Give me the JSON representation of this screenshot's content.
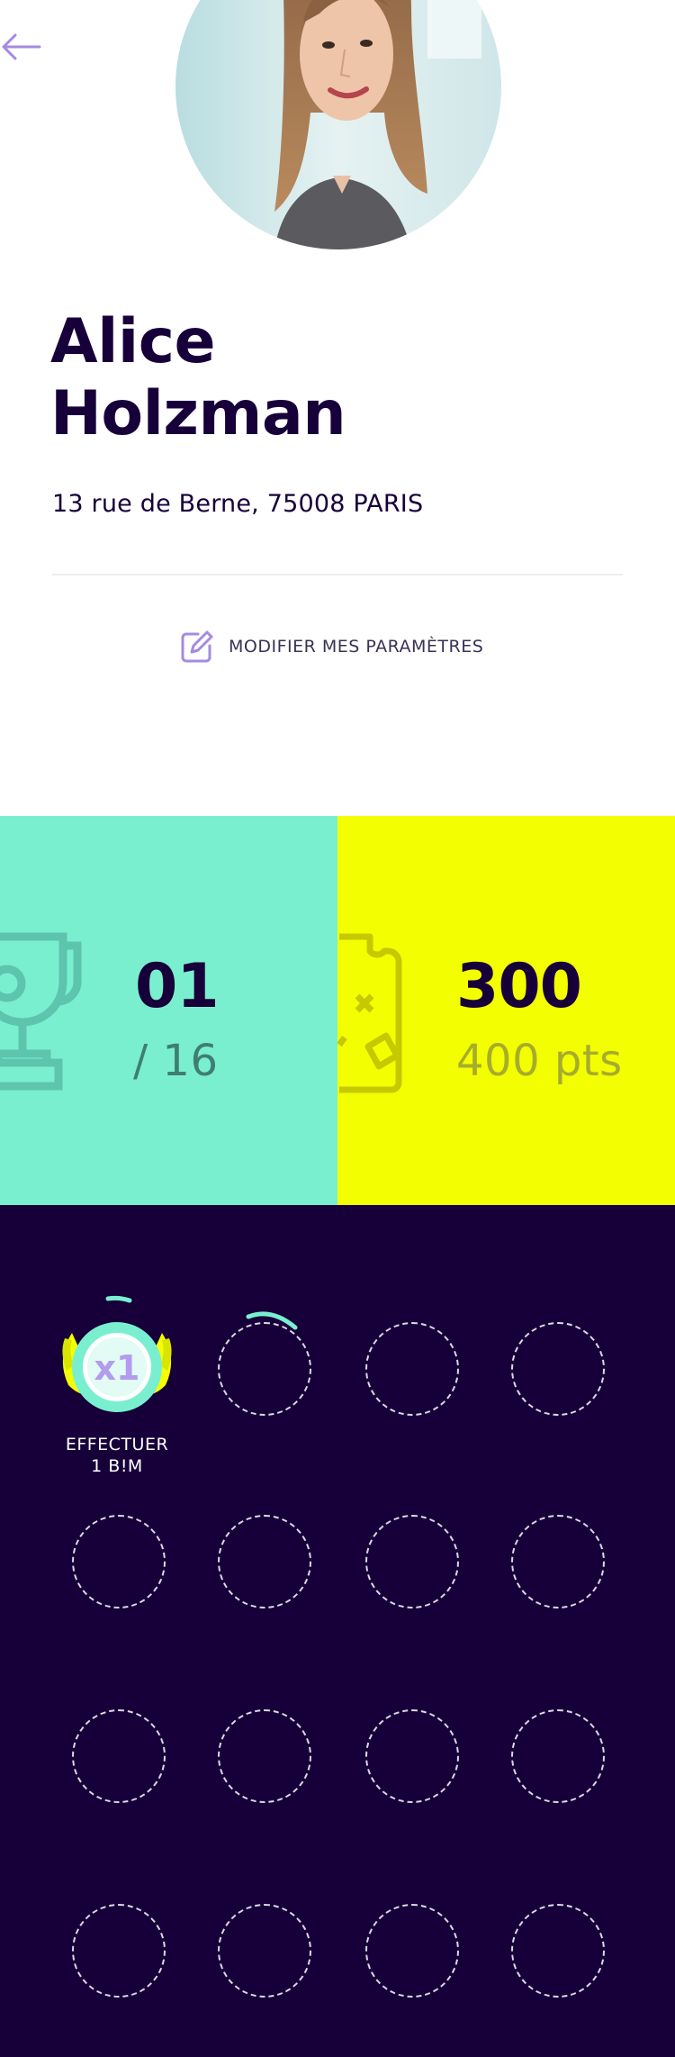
{
  "header": {
    "back_icon": "arrow-left-icon",
    "accent_color": "#a48be0"
  },
  "profile": {
    "first_name": "Alice",
    "last_name": "Holzman",
    "address": "13 rue de Berne, 75008 PARIS",
    "avatar": "profile-photo"
  },
  "settings": {
    "label": "MODIFIER MES PARAMÈTRES",
    "icon": "edit-icon"
  },
  "stats": {
    "trophies": {
      "value": "01",
      "total": "/ 16",
      "icon": "trophy-icon",
      "color": "#7aefcf"
    },
    "points": {
      "value": "300",
      "total": "400 pts",
      "icon": "bonus-card-icon",
      "color": "#f3ff00"
    }
  },
  "badges": {
    "background": "#17003a",
    "items": [
      {
        "state": "earned",
        "badge_text": "x1",
        "caption_line1": "EFFECTUER",
        "caption_line2": "1 B!M"
      },
      {
        "state": "in-progress"
      },
      {
        "state": "locked"
      },
      {
        "state": "locked"
      },
      {
        "state": "locked"
      },
      {
        "state": "locked"
      },
      {
        "state": "locked"
      },
      {
        "state": "locked"
      },
      {
        "state": "locked"
      },
      {
        "state": "locked"
      },
      {
        "state": "locked"
      },
      {
        "state": "locked"
      },
      {
        "state": "locked"
      },
      {
        "state": "locked"
      },
      {
        "state": "locked"
      },
      {
        "state": "locked"
      }
    ]
  }
}
